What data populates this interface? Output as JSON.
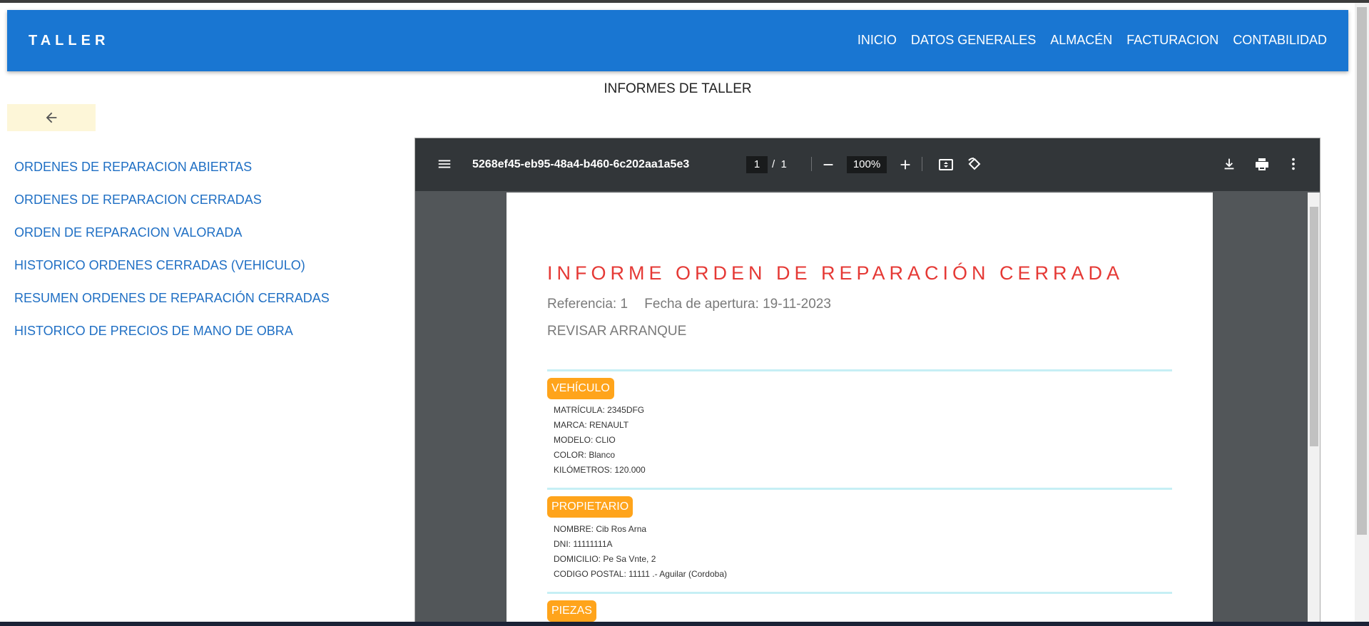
{
  "navbar": {
    "brand": "TALLER",
    "links": [
      "INICIO",
      "DATOS GENERALES",
      "ALMACÉN",
      "FACTURACION",
      "CONTABILIDAD"
    ]
  },
  "page_title": "INFORMES DE TALLER",
  "menu": [
    "ORDENES DE REPARACION ABIERTAS",
    "ORDENES DE REPARACION CERRADAS",
    "ORDEN DE REPARACION VALORADA",
    "HISTORICO ORDENES CERRADAS (VEHICULO)",
    "RESUMEN ORDENES DE REPARACIÓN CERRADAS",
    "HISTORICO DE PRECIOS DE MANO DE OBRA"
  ],
  "viewer": {
    "filename": "5268ef45-eb95-48a4-b460-6c202aa1a5e3",
    "page_current": "1",
    "page_sep": "/",
    "page_total": "1",
    "zoom": "100%"
  },
  "doc": {
    "title": "INFORME ORDEN DE REPARACIÓN CERRADA",
    "referencia": "Referencia: 1",
    "fecha": "Fecha de apertura:  19-11-2023",
    "subtitle": "REVISAR ARRANQUE",
    "vehiculo": {
      "label": "VEHÍCULO",
      "fields": [
        "MATRÍCULA: 2345DFG",
        "MARCA: RENAULT",
        "MODELO: CLIO",
        "COLOR: Blanco",
        "KILÓMETROS: 120.000"
      ]
    },
    "propietario": {
      "label": "PROPIETARIO",
      "fields": [
        "NOMBRE: Cib Ros Arna",
        "DNI: 11111111A",
        "DOMICILIO: Pe Sa Vnte, 2",
        "CODIGO POSTAL: 11111 .- Aguilar (Cordoba)"
      ]
    },
    "piezas": {
      "label": "PIEZAS"
    }
  },
  "colors": {
    "navbar": "#1976d2",
    "menu_link": "#1f6fc4",
    "doc_title": "#e53935",
    "badge": "#ffa41b",
    "divider": "#c6eff5",
    "viewer_toolbar": "#323639",
    "viewer_bg": "#525659"
  },
  "icons": {
    "back": "arrow-left-icon",
    "viewer_menu": "hamburger-menu-icon",
    "zoom_out": "minus-icon",
    "zoom_in": "plus-icon",
    "fit": "fit-page-icon",
    "rotate": "rotate-icon",
    "download": "download-icon",
    "print": "print-icon",
    "more": "more-vert-icon"
  }
}
